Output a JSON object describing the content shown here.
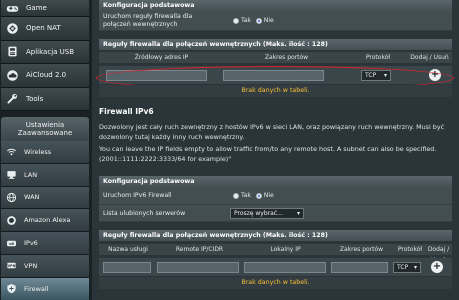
{
  "sidebar": {
    "top_items": [
      {
        "label": "Game",
        "icon": "gamepad-icon"
      },
      {
        "label": "Open NAT",
        "icon": "open-nat-icon"
      },
      {
        "label": "Aplikacja USB",
        "icon": "usb-icon"
      },
      {
        "label": "AiCloud 2.0",
        "icon": "cloud-icon"
      },
      {
        "label": "Tools",
        "icon": "tools-icon"
      }
    ],
    "advanced_header": "Ustawienia Zaawansowane",
    "advanced_items": [
      {
        "label": "Wireless",
        "icon": "wifi-icon"
      },
      {
        "label": "LAN",
        "icon": "lan-icon"
      },
      {
        "label": "WAN",
        "icon": "globe-icon"
      },
      {
        "label": "Amazon Alexa",
        "icon": "alexa-icon"
      },
      {
        "label": "IPv6",
        "icon": "ipv6-icon"
      },
      {
        "label": "VPN",
        "icon": "vpn-icon"
      },
      {
        "label": "Firewall",
        "icon": "firewall-icon",
        "active": true
      }
    ]
  },
  "basic_config": {
    "title": "Konfiguracja podstawowa",
    "enable_rules_label": "Uruchom reguły firewalla dla połączeń wewnętrznych",
    "yes": "Tak",
    "no": "Nie"
  },
  "rules_table": {
    "title": "Reguły firewalla dla połączeń wewnętrznych (Maks. ilość : 128)",
    "columns": [
      "Źródłowy adres IP",
      "Zakres portów",
      "Protokół",
      "Dodaj / Usuń"
    ],
    "protocol_value": "TCP",
    "empty_message": "Brak danych w tabeli."
  },
  "ipv6": {
    "title": "Firewall IPv6",
    "description": "Dozwolony jest cały ruch zewnętrzny z hostów IPv6 w sieci LAN, oraz powiązany ruch wewnętrzny. Musi być dozwolony tutaj każdy inny ruch wewnętrzny.",
    "hint": "You can leave the IP fields empty to allow traffic from/to any remote host. A subnet can also be specified. (2001::1111:2222:3333/64 for example)\"",
    "config_title": "Konfiguracja podstawowa",
    "enable_label": "Uruchom IPv6 Firewall",
    "yes": "Tak",
    "no": "Nie",
    "favorites_label": "Lista ulubionych serwerów",
    "favorites_select": "Proszę wybrać..."
  },
  "ipv6_rules": {
    "title": "Reguły firewalla dla połączeń wewnętrznych (Maks. ilość : 128)",
    "columns": [
      "Nazwa usługi",
      "Remote IP/CIDR",
      "Lokalny IP",
      "Zakres portów",
      "Protokół",
      "Dodaj / Usuń"
    ],
    "protocol_value": "TCP",
    "empty_message": "Brak danych w tabeli."
  },
  "colors": {
    "empty_text": "#f7c137",
    "highlight_ellipse": "#d9222a",
    "active_menu": "#5f7c88"
  }
}
